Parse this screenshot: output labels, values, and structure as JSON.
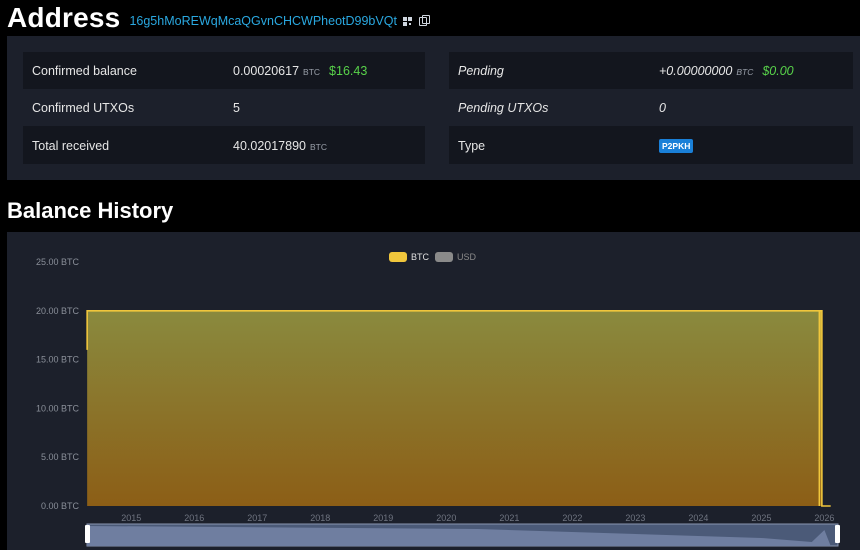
{
  "header": {
    "title": "Address",
    "address": "16g5hMoREWqMcaQGvnCHCWPheotD99bVQt"
  },
  "summary": {
    "left": [
      {
        "label": "Confirmed balance",
        "value": "0.00020617",
        "unit": "BTC",
        "usd": "$16.43"
      },
      {
        "label": "Confirmed UTXOs",
        "value": "5"
      },
      {
        "label": "Total received",
        "value": "40.02017890",
        "unit": "BTC"
      }
    ],
    "right": [
      {
        "label": "Pending",
        "value": "+0.00000000",
        "unit": "BTC",
        "usd": "$0.00"
      },
      {
        "label": "Pending UTXOs",
        "value": "0"
      },
      {
        "label": "Type",
        "badge": "P2PKH"
      }
    ]
  },
  "balance_history": {
    "title": "Balance History"
  },
  "colors": {
    "accent_link": "#2aa8e0",
    "usd_green": "#58d24a",
    "btc_series": "#f0c63c",
    "usd_series": "#8a8a8a",
    "badge": "#1a80d8"
  },
  "chart_data": {
    "type": "area",
    "legend": [
      "BTC",
      "USD"
    ],
    "legend_position": "top-center",
    "y_ticks": [
      "25.00 BTC",
      "20.00 BTC",
      "15.00 BTC",
      "10.00 BTC",
      "5.00 BTC",
      "0.00 BTC"
    ],
    "ylim": [
      0,
      25
    ],
    "x_ticks": [
      "2015",
      "2016",
      "2017",
      "2018",
      "2019",
      "2020",
      "2021",
      "2022",
      "2023",
      "2024",
      "2025",
      "2026"
    ],
    "xlim": [
      2014.75,
      2026.7
    ],
    "series": [
      {
        "name": "BTC",
        "x": [
          2014.8,
          2014.8,
          2014.81,
          2026.42,
          2026.42,
          2026.43,
          2026.46,
          2026.46,
          2026.6
        ],
        "y": [
          16,
          20,
          20,
          20,
          0,
          20,
          20,
          0,
          0
        ]
      }
    ]
  }
}
